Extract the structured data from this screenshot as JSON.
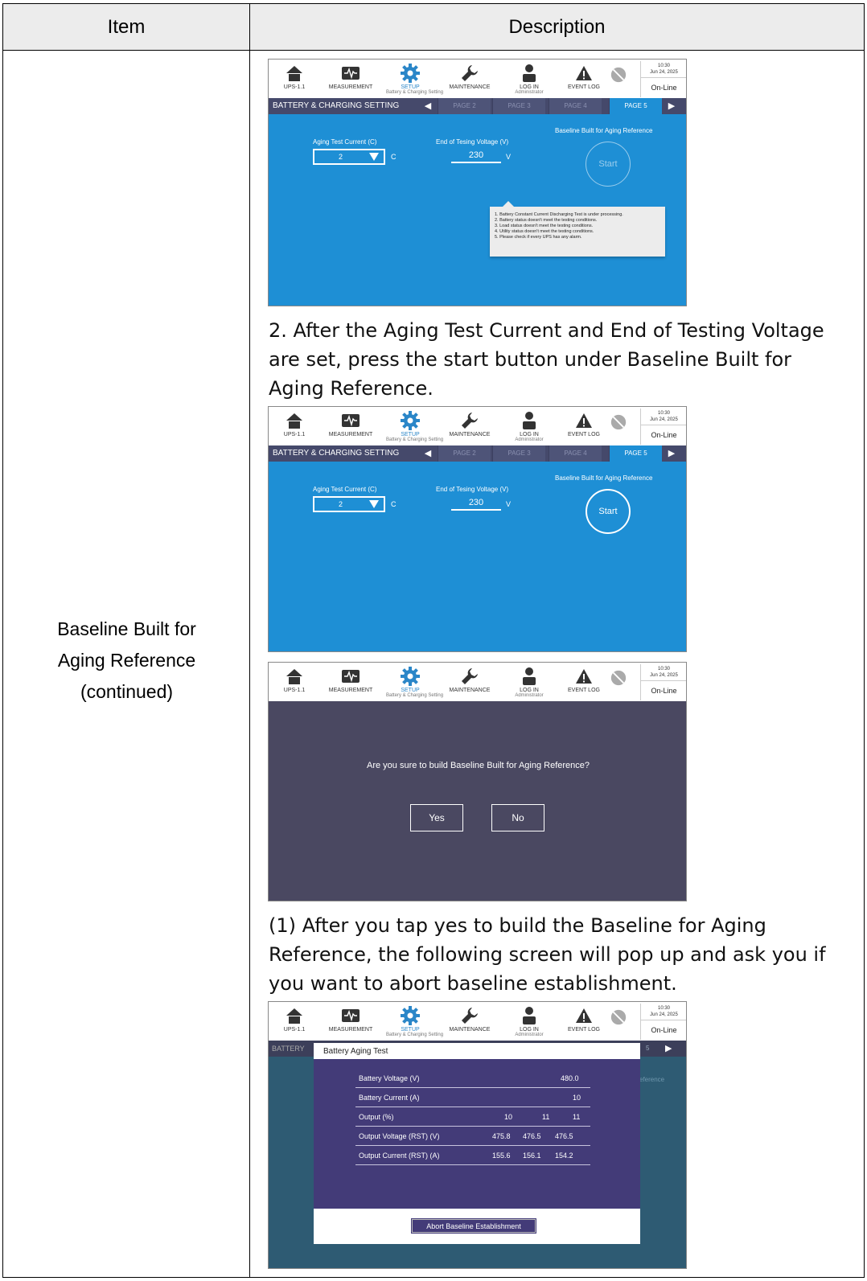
{
  "table": {
    "header": {
      "item": "Item",
      "description": "Description"
    },
    "item_name": [
      "Baseline Built for",
      "Aging Reference",
      "(continued)"
    ]
  },
  "ui": {
    "nav": {
      "ups": "UPS-1.1",
      "measurement": "MEASUREMENT",
      "setup": "SETUP",
      "setup_sub": "Battery & Charging Setting",
      "maintenance": "MAINTENANCE",
      "login": "LOG IN",
      "login_sub": "Administrator",
      "event_log": "EVENT LOG"
    },
    "time": "10:30",
    "date": "Jun 24, 2025",
    "status": "On-Line",
    "section_title": "BATTERY & CHARGING SETTING",
    "pages": [
      "PAGE 2",
      "PAGE 3",
      "PAGE 4",
      "PAGE 5"
    ],
    "aging_current_label": "Aging Test Current (C)",
    "aging_current_value": "2",
    "aging_current_unit": "C",
    "end_voltage_label": "End of Tesing Voltage (V)",
    "end_voltage_value": "230",
    "end_voltage_unit": "V",
    "baseline_label": "Baseline Built for Aging Reference",
    "start_label": "Start",
    "tooltip_lines": [
      "1. Battery Constant Current Discharging Test is under processing.",
      "2. Battery status doesn't meet the testing conditions.",
      "3. Load status doesn't meet the testing conditions.",
      "4. Utility status doesn't meet the testing conditions.",
      "5. Please check if every UPS has any alarm."
    ],
    "confirm_question": "Are you sure to build Baseline Built for Aging Reference?",
    "yes": "Yes",
    "no": "No",
    "bg_tab_text": "BATTERY",
    "bg_page_num": "5",
    "bg_reference_fragment": "eference",
    "aging_modal": {
      "title": "Battery Aging Test",
      "rows": [
        {
          "label": "Battery Voltage (V)",
          "values": [
            "480.0"
          ]
        },
        {
          "label": "Battery Current (A)",
          "values": [
            "10"
          ]
        },
        {
          "label": "Output (%)",
          "values": [
            "10",
            "11",
            "11"
          ]
        },
        {
          "label": "Output Voltage (RST) (V)",
          "values": [
            "475.8",
            "476.5",
            "476.5"
          ]
        },
        {
          "label": "Output Current (RST) (A)",
          "values": [
            "155.6",
            "156.1",
            "154.2"
          ]
        }
      ],
      "abort_label": "Abort Baseline Establishment"
    }
  },
  "paragraphs": {
    "step2": "2. After the Aging Test Current and End of Testing Voltage are set, press the start button under Baseline Built for Aging Reference.",
    "step2_1": "(1) After you tap yes to build the Baseline for Aging Reference, the following screen will pop up and ask you if you want to abort baseline establishment."
  },
  "colors": {
    "screen_blue": "#1e8fd5",
    "tab_bar": "#45496b",
    "dialog_bg": "#4a4861",
    "modal_purple": "#433b78",
    "header_gray": "#ececec"
  }
}
